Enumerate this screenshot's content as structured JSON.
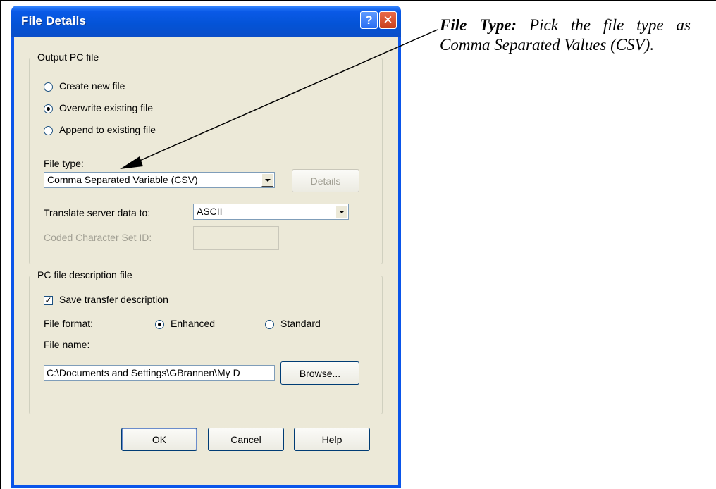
{
  "dialog": {
    "title": "File Details",
    "help_button": "?",
    "close_button": "✕"
  },
  "output_group": {
    "label": "Output PC file",
    "radios": [
      {
        "label": "Create new file",
        "checked": false
      },
      {
        "label": "Overwrite existing file",
        "checked": true
      },
      {
        "label": "Append to existing file",
        "checked": false
      }
    ],
    "file_type_label": "File type:",
    "file_type_value": "Comma Separated Variable (CSV)",
    "details_button": "Details",
    "translate_label": "Translate server data to:",
    "translate_value": "ASCII",
    "ccsid_label": "Coded Character Set ID:",
    "ccsid_value": ""
  },
  "desc_group": {
    "label": "PC file description file",
    "save_checkbox_label": "Save transfer description",
    "save_checked": true,
    "file_format_label": "File format:",
    "format_options": [
      {
        "label": "Enhanced",
        "checked": true
      },
      {
        "label": "Standard",
        "checked": false
      }
    ],
    "file_name_label": "File name:",
    "file_name_value": "C:\\Documents and Settings\\GBrannen\\My D",
    "browse_button": "Browse..."
  },
  "footer_buttons": {
    "ok": "OK",
    "cancel": "Cancel",
    "help": "Help"
  },
  "annotation": {
    "heading": "File Type:",
    "body": " Pick the file type as Comma Separated Values (CSV)."
  },
  "colors": {
    "title_bar": "#0a55ea",
    "dialog_face": "#ece9d8",
    "radio_selected": "#21a121"
  },
  "icons": {
    "help": "question-mark-icon",
    "close": "close-icon",
    "dropdown": "chevron-down-icon",
    "arrow": "callout-arrow-icon"
  }
}
